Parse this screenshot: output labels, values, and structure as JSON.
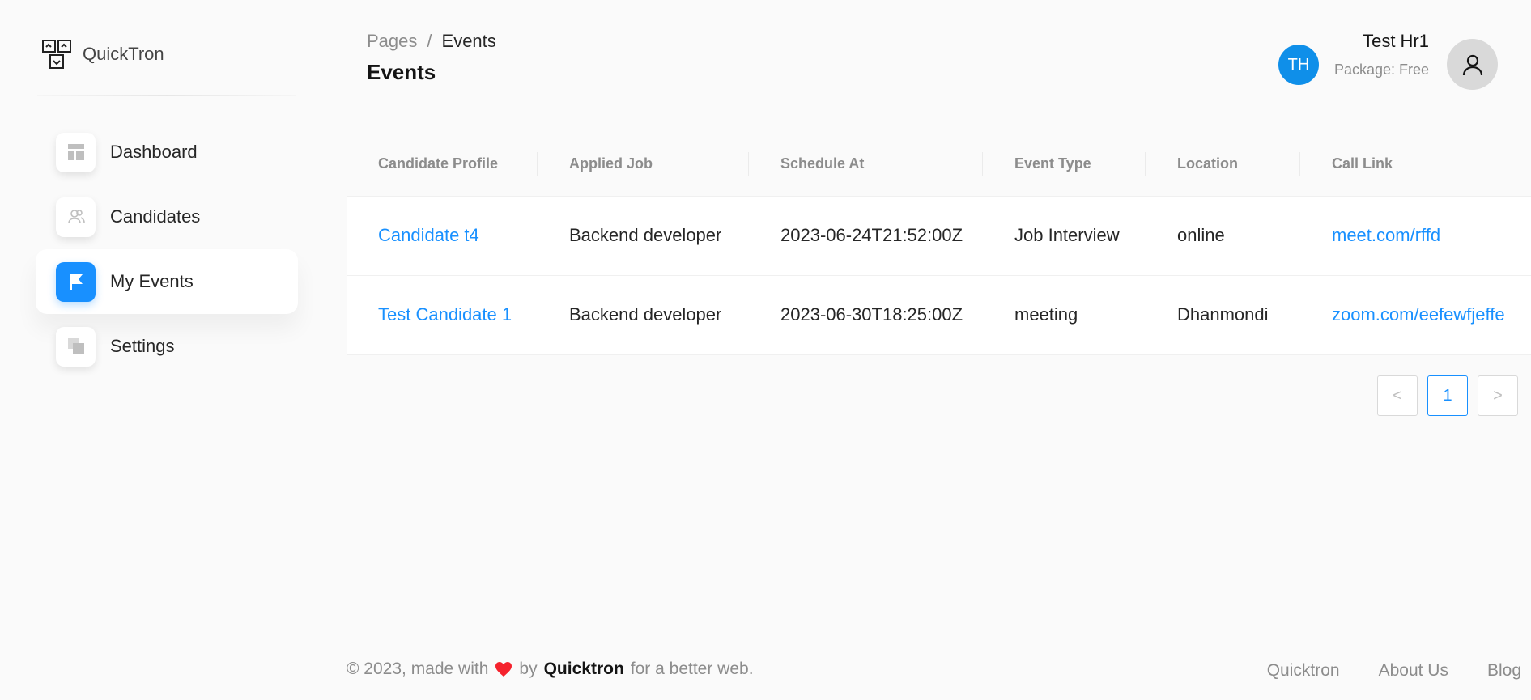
{
  "brand": {
    "name": "QuickTron"
  },
  "sidebar": {
    "items": [
      {
        "label": "Dashboard",
        "icon": "dashboard-icon",
        "active": false
      },
      {
        "label": "Candidates",
        "icon": "users-icon",
        "active": false
      },
      {
        "label": "My Events",
        "icon": "flag-icon",
        "active": true
      },
      {
        "label": "Settings",
        "icon": "copy-icon",
        "active": false
      }
    ]
  },
  "header": {
    "breadcrumb": {
      "parent": "Pages",
      "separator": "/",
      "current": "Events"
    },
    "title": "Events",
    "user": {
      "initials": "TH",
      "name": "Test Hr1",
      "package": "Package: Free"
    }
  },
  "table": {
    "columns": [
      "Candidate Profile",
      "Applied Job",
      "Schedule At",
      "Event Type",
      "Location",
      "Call Link"
    ],
    "rows": [
      {
        "candidate": "Candidate t4",
        "job": "Backend developer",
        "schedule": "2023-06-24T21:52:00Z",
        "type": "Job Interview",
        "location": "online",
        "link": "meet.com/rffd"
      },
      {
        "candidate": "Test Candidate 1",
        "job": "Backend developer",
        "schedule": "2023-06-30T18:25:00Z",
        "type": "meeting",
        "location": "Dhanmondi",
        "link": "zoom.com/eefewfjeffe"
      }
    ]
  },
  "pagination": {
    "prev": "<",
    "current": "1",
    "next": ">"
  },
  "footer": {
    "copyright": "© 2023, made with",
    "by": "by",
    "brand": "Quicktron",
    "tagline": "for a better web.",
    "links": [
      "Quicktron",
      "About Us",
      "Blog"
    ]
  },
  "colors": {
    "accent": "#1890ff",
    "badge": "#0f8fe9",
    "heart": "#f5222d"
  }
}
